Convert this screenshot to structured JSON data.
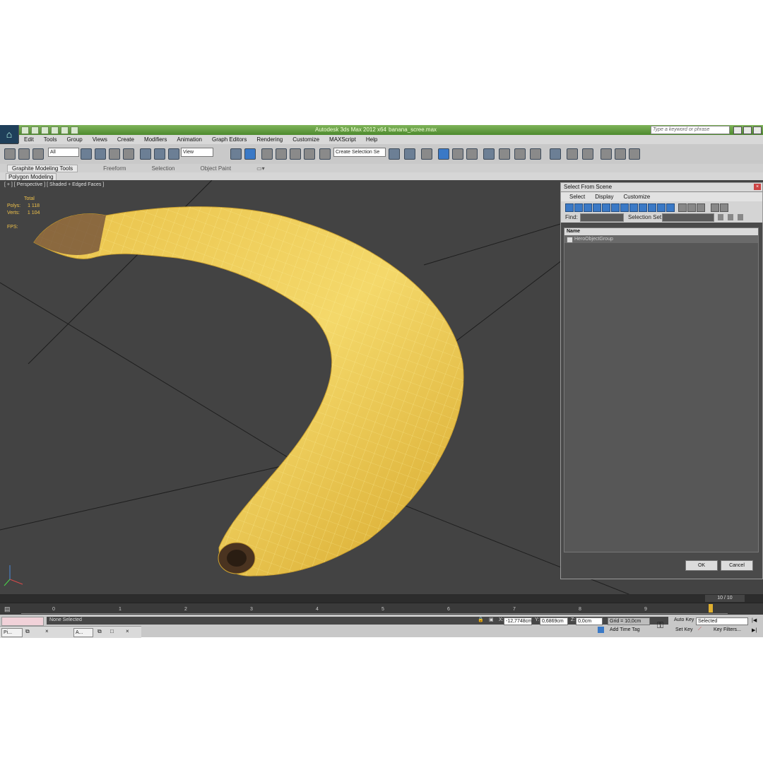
{
  "title": {
    "app": "Autodesk 3ds Max  2012 x64",
    "file": "banana_scree.max",
    "search_placeholder": "Type a keyword or phrase"
  },
  "menu": [
    "Edit",
    "Tools",
    "Group",
    "Views",
    "Create",
    "Modifiers",
    "Animation",
    "Graph Editors",
    "Rendering",
    "Customize",
    "MAXScript",
    "Help"
  ],
  "toolbar": {
    "filter": "All",
    "ref_coord": "View",
    "named_selection": "Create Selection Se"
  },
  "ribbon": {
    "tabs": [
      "Graphite Modeling Tools",
      "Freeform",
      "Selection",
      "Object Paint"
    ],
    "panel": "Polygon Modeling"
  },
  "viewport": {
    "label": "[ + ] [ Perspective ] [ Shaded + Edged Faces ]",
    "total": "Total",
    "polys_label": "Polys:",
    "polys": "1 118",
    "verts_label": "Verts:",
    "verts": "1 104",
    "fps_label": "FPS:"
  },
  "dialog": {
    "title": "Select From Scene",
    "menu": [
      "Select",
      "Display",
      "Customize"
    ],
    "find_label": "Find:",
    "selset_label": "Selection Set:",
    "column": "Name",
    "items": [
      "HeroObjectGroup"
    ],
    "ok": "OK",
    "cancel": "Cancel"
  },
  "timeline": {
    "frame": "10 / 10",
    "ticks": [
      "0",
      "1",
      "2",
      "3",
      "4",
      "5",
      "6",
      "7",
      "8",
      "9"
    ]
  },
  "status": {
    "selection": "None Selected",
    "x_label": "X:",
    "x": "-12,7748cm",
    "y_label": "Y:",
    "y": "0,6869cm",
    "z_label": "Z:",
    "z": "0,0cm",
    "grid": "Grid = 10,0cm",
    "add_time_tag": "Add Time Tag",
    "auto_key": "Auto Key",
    "selected": "Selected",
    "set_key": "Set Key",
    "key_filters": "Key Filters..."
  },
  "taskbar": [
    "Pi...",
    "A..."
  ]
}
